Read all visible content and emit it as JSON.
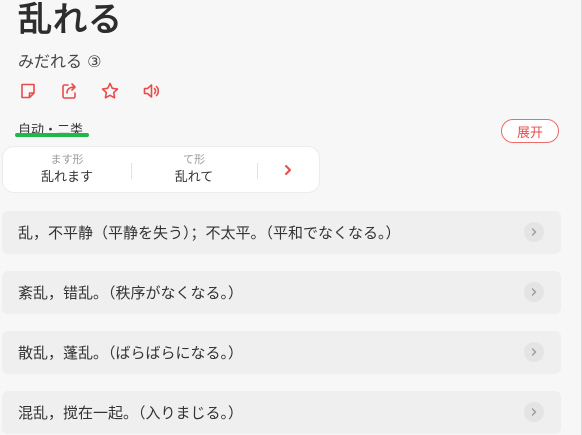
{
  "word": {
    "title": "乱れる",
    "reading": "みだれる ③"
  },
  "toolbar": {
    "icons": [
      "note-icon",
      "share-icon",
      "star-icon",
      "speaker-icon"
    ]
  },
  "word_type": {
    "label": "自动・二类",
    "expand_label": "展开"
  },
  "conjugation": {
    "columns": [
      {
        "label": "ます形",
        "value": "乱れます"
      },
      {
        "label": "て形",
        "value": "乱れて"
      }
    ]
  },
  "meanings": [
    "乱，不平静（平静を失う）；不太平。（平和でなくなる。）",
    "紊乱，错乱。（秩序がなくなる。）",
    "散乱，蓬乱。（ばらばらになる。）",
    "混乱，搅在一起。（入りまじる。）"
  ],
  "colors": {
    "accent_red": "#e94b4b",
    "underline_green": "#1fb84a"
  }
}
